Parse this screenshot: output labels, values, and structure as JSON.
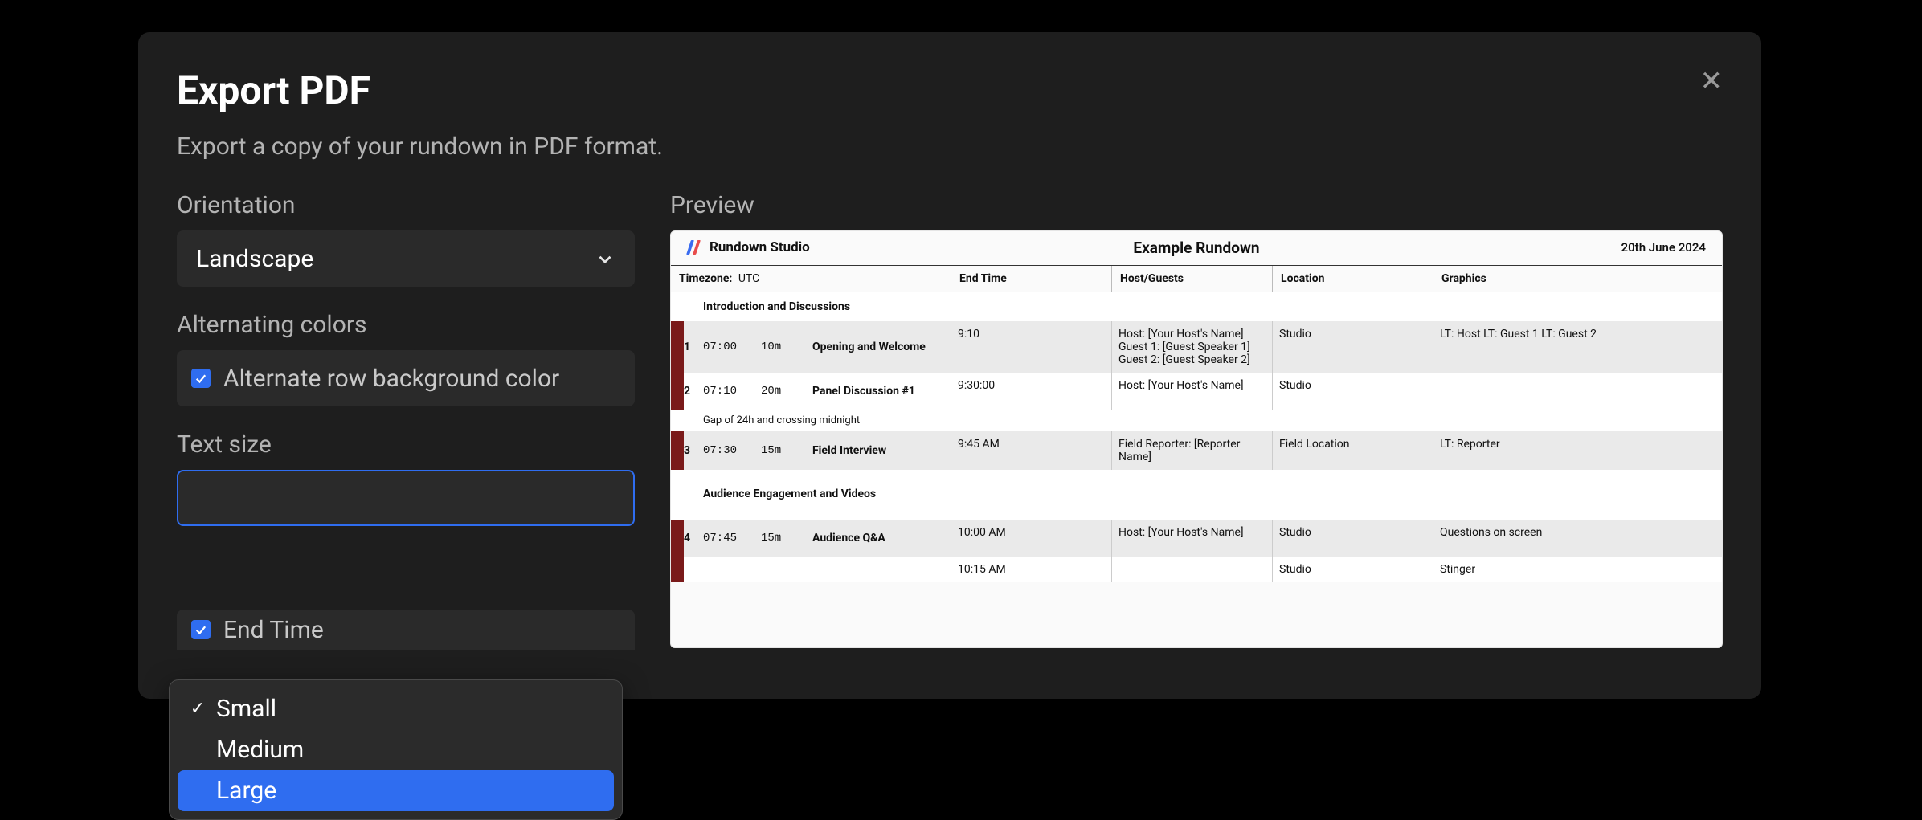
{
  "modal": {
    "title": "Export PDF",
    "subtitle": "Export a copy of your rundown in PDF format."
  },
  "orientation": {
    "label": "Orientation",
    "value": "Landscape"
  },
  "altcolors": {
    "label": "Alternating colors",
    "option": "Alternate row background color"
  },
  "textsize": {
    "label": "Text size",
    "options": [
      "Small",
      "Medium",
      "Large"
    ],
    "selected": "Small",
    "highlighted": "Large"
  },
  "endtime_checkbox": {
    "label": "End Time"
  },
  "preview": {
    "label": "Preview",
    "brand": "Rundown Studio",
    "doc_title": "Example Rundown",
    "date": "20th June 2024",
    "tz_label": "Timezone:",
    "tz_value": "UTC",
    "columns": [
      "End Time",
      "Host/Guests",
      "Location",
      "Graphics"
    ],
    "sections": [
      {
        "heading": "Introduction and Discussions",
        "rows": [
          {
            "idx": "1",
            "start": "07:00",
            "dur": "10m",
            "title": "Opening and Welcome",
            "end": "9:10",
            "host": "Host: [Your Host's Name] Guest 1: [Guest Speaker 1] Guest 2: [Guest Speaker 2]",
            "loc": "Studio",
            "gfx": "LT: Host LT: Guest 1 LT: Guest 2",
            "alt": true
          },
          {
            "idx": "2",
            "start": "07:10",
            "dur": "20m",
            "title": "Panel Discussion #1",
            "end": "9:30:00",
            "host": "Host: [Your Host's Name]",
            "loc": "Studio",
            "gfx": "",
            "alt": false,
            "note": "Gap of 24h and crossing midnight"
          },
          {
            "idx": "3",
            "start": "07:30",
            "dur": "15m",
            "title": "Field Interview",
            "end": "9:45 AM",
            "host": "Field Reporter: [Reporter Name]",
            "loc": "Field Location",
            "gfx": "LT: Reporter",
            "alt": true
          }
        ]
      },
      {
        "heading": "Audience Engagement and Videos",
        "rows": [
          {
            "idx": "4",
            "start": "07:45",
            "dur": "15m",
            "title": "Audience Q&A",
            "end": "10:00 AM",
            "host": "Host: [Your Host's Name]",
            "loc": "Studio",
            "gfx": "Questions on screen",
            "alt": true
          },
          {
            "idx": "",
            "start": "",
            "dur": "",
            "title": "",
            "end": "10:15 AM",
            "host": "",
            "loc": "Studio",
            "gfx": "Stinger",
            "alt": false
          }
        ]
      }
    ]
  }
}
